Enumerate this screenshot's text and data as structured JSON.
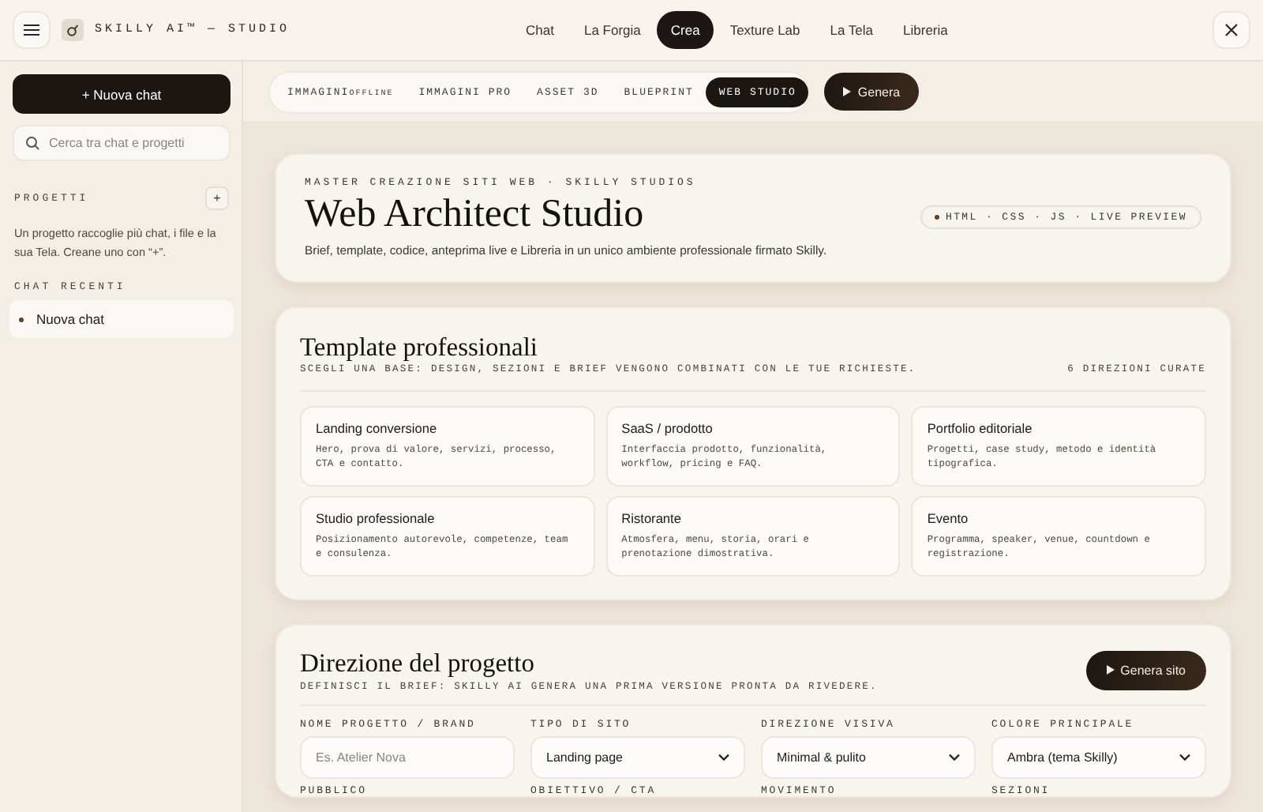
{
  "header": {
    "brand": "SKILLY AI™ — STUDIO"
  },
  "nav": [
    {
      "label": "Chat",
      "selected": false
    },
    {
      "label": "La Forgia",
      "selected": false
    },
    {
      "label": "Crea",
      "selected": true
    },
    {
      "label": "Texture Lab",
      "selected": false
    },
    {
      "label": "La Tela",
      "selected": false
    },
    {
      "label": "Libreria",
      "selected": false
    }
  ],
  "sidebar": {
    "new_chat": "+ Nuova chat",
    "search": {
      "placeholder": "Cerca tra chat e progetti"
    },
    "projects_title": "PROGETTI",
    "add_project": "+",
    "projects_hint": "Un progetto raccoglie più chat, i file e la sua Tela. Creane uno con “+”.",
    "recent_title": "CHAT RECENTI",
    "recent_chats": [
      {
        "label": "Nuova chat",
        "selected": true
      }
    ]
  },
  "mode_tabs": [
    {
      "label": "IMMAGINI",
      "badge": "OFFLINE",
      "selected": false
    },
    {
      "label": "IMMAGINI PRO",
      "selected": false
    },
    {
      "label": "ASSET 3D",
      "selected": false
    },
    {
      "label": "BLUEPRINT",
      "selected": false
    },
    {
      "label": "WEB STUDIO",
      "selected": true
    }
  ],
  "generate_button": "Genera",
  "hero": {
    "eyebrow": "MASTER CREAZIONE SITI WEB · SKILLY STUDIOS",
    "title": "Web Architect Studio",
    "subtitle": "Brief, template, codice, anteprima live e Libreria in un unico ambiente professionale firmato Skilly.",
    "badge": "HTML · CSS · JS · LIVE PREVIEW"
  },
  "templates": {
    "title": "Template professionali",
    "subtitle": "SCEGLI UNA BASE: DESIGN, SEZIONI E BRIEF VENGONO COMBINATI CON LE TUE RICHIESTE.",
    "count": "6 DIREZIONI CURATE",
    "items": [
      {
        "title": "Landing conversione",
        "description": "Hero, prova di valore, servizi, processo, CTA e contatto."
      },
      {
        "title": "SaaS / prodotto",
        "description": "Interfaccia prodotto, funzionalità, workflow, pricing e FAQ."
      },
      {
        "title": "Portfolio editoriale",
        "description": "Progetti, case study, metodo e identità tipografica."
      },
      {
        "title": "Studio professionale",
        "description": "Posizionamento autorevole, competenze, team e consulenza."
      },
      {
        "title": "Ristorante",
        "description": "Atmosfera, menu, storia, orari e prenotazione dimostrativa."
      },
      {
        "title": "Evento",
        "description": "Programma, speaker, venue, countdown e registrazione."
      }
    ]
  },
  "direction": {
    "title": "Direzione del progetto",
    "subtitle": "DEFINISCI IL BRIEF: SKILLY AI GENERA UNA PRIMA VERSIONE PRONTA DA RIVEDERE.",
    "button": "Genera sito",
    "fields": [
      {
        "label": "NOME PROGETTO / BRAND",
        "kind": "input",
        "placeholder": "Es. Atelier Nova"
      },
      {
        "label": "TIPO DI SITO",
        "kind": "select",
        "value": "Landing page"
      },
      {
        "label": "DIREZIONE VISIVA",
        "kind": "select",
        "value": "Minimal & pulito"
      },
      {
        "label": "COLORE PRINCIPALE",
        "kind": "select",
        "value": "Ambra (tema Skilly)"
      },
      {
        "label": "PUBBLICO"
      },
      {
        "label": "OBIETTIVO / CTA"
      },
      {
        "label": "MOVIMENTO"
      },
      {
        "label": "SEZIONI"
      }
    ]
  }
}
